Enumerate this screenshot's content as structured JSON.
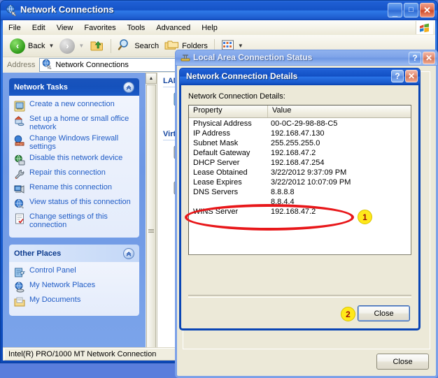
{
  "window": {
    "title": "Network Connections",
    "icon": "network-connections-icon",
    "buttons": {
      "minimize": "_",
      "maximize": "□",
      "close": "✕"
    }
  },
  "menu": {
    "items": [
      "File",
      "Edit",
      "View",
      "Favorites",
      "Tools",
      "Advanced",
      "Help"
    ]
  },
  "toolbar": {
    "back_label": "Back",
    "forward_label": "",
    "up_label": "",
    "search_label": "Search",
    "folders_label": "Folders",
    "views_label": "",
    "dropdown_caret": "▼"
  },
  "address": {
    "label": "Address",
    "value": "Network Connections",
    "icon": "network-globe-icon"
  },
  "task_pane": {
    "network_tasks": {
      "title": "Network Tasks",
      "collapse_glyph": "»",
      "items": [
        {
          "label": "Create a new connection",
          "icon": "new-connection-icon"
        },
        {
          "label": "Set up a home or small office network",
          "icon": "home-network-icon"
        },
        {
          "label": "Change Windows Firewall settings",
          "icon": "firewall-icon"
        },
        {
          "label": "Disable this network device",
          "icon": "disable-device-icon"
        },
        {
          "label": "Repair this connection",
          "icon": "repair-wrench-icon"
        },
        {
          "label": "Rename this connection",
          "icon": "rename-icon"
        },
        {
          "label": "View status of this connection",
          "icon": "view-status-icon"
        },
        {
          "label": "Change settings of this connection",
          "icon": "settings-icon"
        }
      ]
    },
    "other_places": {
      "title": "Other Places",
      "collapse_glyph": "»",
      "items": [
        {
          "label": "Control Panel",
          "icon": "control-panel-icon"
        },
        {
          "label": "My Network Places",
          "icon": "my-network-places-icon"
        },
        {
          "label": "My Documents",
          "icon": "my-documents-icon"
        }
      ]
    }
  },
  "list_view": {
    "groups": [
      {
        "header": "LAN"
      },
      {
        "header": "Virtu"
      }
    ],
    "scroll_up_glyph": "▲",
    "scroll_down_glyph": "▼"
  },
  "status_bar": {
    "text": "Intel(R) PRO/1000 MT Network Connection"
  },
  "status_dialog": {
    "title": "Local Area Connection Status",
    "icon": "network-status-icon",
    "help_glyph": "?",
    "close_glyph": "✕",
    "close_button": "Close"
  },
  "details_dialog": {
    "title": "Network Connection Details",
    "help_glyph": "?",
    "close_glyph": "✕",
    "caption": "Network Connection Details:",
    "columns": [
      "Property",
      "Value"
    ],
    "rows": [
      {
        "property": "Physical Address",
        "value": "00-0C-29-98-88-C5"
      },
      {
        "property": "IP Address",
        "value": "192.168.47.130"
      },
      {
        "property": "Subnet Mask",
        "value": "255.255.255.0"
      },
      {
        "property": "Default Gateway",
        "value": "192.168.47.2"
      },
      {
        "property": "DHCP Server",
        "value": "192.168.47.254"
      },
      {
        "property": "Lease Obtained",
        "value": "3/22/2012 9:37:09 PM"
      },
      {
        "property": "Lease Expires",
        "value": "3/22/2012 10:07:09 PM"
      },
      {
        "property": "DNS Servers",
        "value": "8.8.8.8"
      },
      {
        "property": "",
        "value": "8.8.4.4"
      },
      {
        "property": "WINS Server",
        "value": "192.168.47.2"
      }
    ],
    "close_button": "Close"
  },
  "annotations": [
    {
      "number": "1",
      "target": "dns-servers-row"
    },
    {
      "number": "2",
      "target": "details-close-button"
    }
  ],
  "colors": {
    "title_active": "#1553c7",
    "title_inactive": "#7fa4e9",
    "annotation_red": "#e8171a",
    "annotation_yellow": "#ffe81a",
    "link_blue": "#215dc6"
  }
}
